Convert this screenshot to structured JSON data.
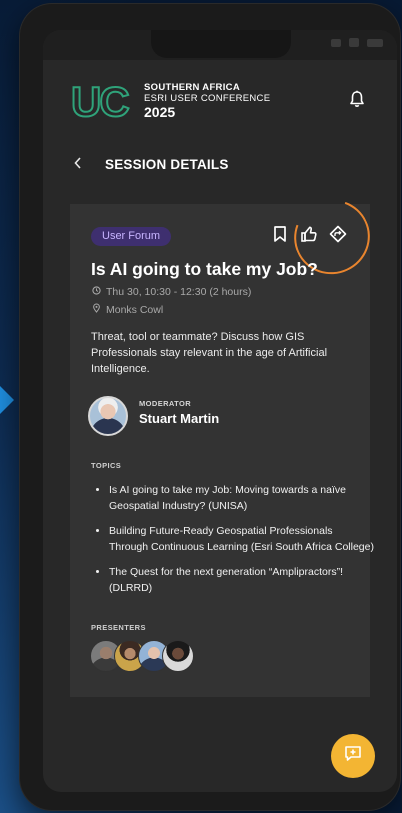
{
  "header": {
    "logo_letters": "UC",
    "logo_line1": "SOUTHERN AFRICA",
    "logo_line2": "ESRI USER CONFERENCE",
    "logo_year": "2025"
  },
  "nav": {
    "title": "SESSION DETAILS"
  },
  "session": {
    "tag": "User Forum",
    "title": "Is AI going to take my Job?",
    "datetime": "Thu 30, 10:30 - 12:30 (2 hours)",
    "location": "Monks Cowl",
    "description": "Threat, tool or teammate? Discuss how GIS Professionals stay relevant in the age of Artificial Intelligence.",
    "moderator_label": "MODERATOR",
    "moderator_name": "Stuart Martin",
    "topics_label": "TOPICS",
    "topics": [
      "Is AI going to take my Job: Moving towards a naïve Geospatial Industry? (UNISA)",
      "Building Future-Ready Geospatial Professionals Through Continuous Learning (Esri South Africa College)",
      "The Quest for the next generation “Amplipractors”! (DLRRD)"
    ],
    "presenters_label": "PRESENTERS"
  },
  "icons": {
    "bookmark": "bookmark-icon",
    "like": "thumbs-up-icon",
    "share": "share-icon",
    "bell": "bell-icon",
    "back": "chevron-left-icon",
    "clock": "clock-icon",
    "location": "location-pin-icon",
    "fab": "feedback-icon"
  },
  "colors": {
    "accent_fab": "#f3b533",
    "tag_bg": "#3e2f6f",
    "tag_text": "#c7b4ff",
    "annotation": "#e9852e"
  }
}
